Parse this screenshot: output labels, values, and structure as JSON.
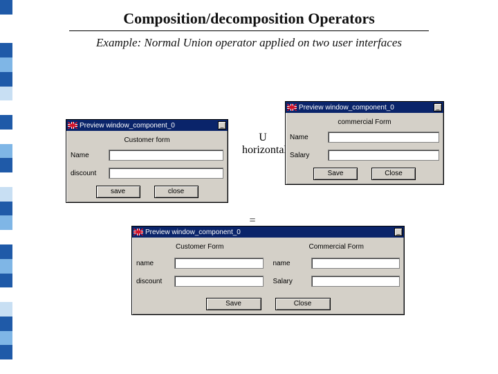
{
  "heading": "Composition/decomposition Operators",
  "subtitle": "Example: Normal Union operator applied on two user interfaces",
  "operator_union_top": "U",
  "operator_union_bottom": "horizontal",
  "operator_equals": "=",
  "strip_colors": [
    "#1f5aa8",
    "#ffffff",
    "#ffffff",
    "#1f5aa8",
    "#7fb6e6",
    "#1f5aa8",
    "#c8dff3",
    "#ffffff",
    "#1f5aa8",
    "#ffffff",
    "#7fb6e6",
    "#1f5aa8",
    "#ffffff",
    "#c8dff3",
    "#1f5aa8",
    "#7fb6e6",
    "#ffffff",
    "#1f5aa8",
    "#7fb6e6",
    "#1f5aa8",
    "#ffffff",
    "#c8dff3",
    "#1f5aa8",
    "#7fb6e6",
    "#1f5aa8",
    "#ffffff"
  ],
  "win_left": {
    "title": "Preview window_component_0",
    "form_title": "Customer form",
    "field1_label": "Name",
    "field2_label": "discount",
    "btn_save": "save",
    "btn_close": "close"
  },
  "win_right": {
    "title": "Preview window_component_0",
    "form_title": "commercial Form",
    "field1_label": "Name",
    "field2_label": "Salary",
    "btn_save": "Save",
    "btn_close": "Close"
  },
  "win_result": {
    "title": "Preview window_component_0",
    "col1_title": "Customer Form",
    "col2_title": "Commercial Form",
    "col1_field1": "name",
    "col1_field2": "discount",
    "col2_field1": "name",
    "col2_field2": "Salary",
    "btn_save": "Save",
    "btn_close": "Close"
  }
}
